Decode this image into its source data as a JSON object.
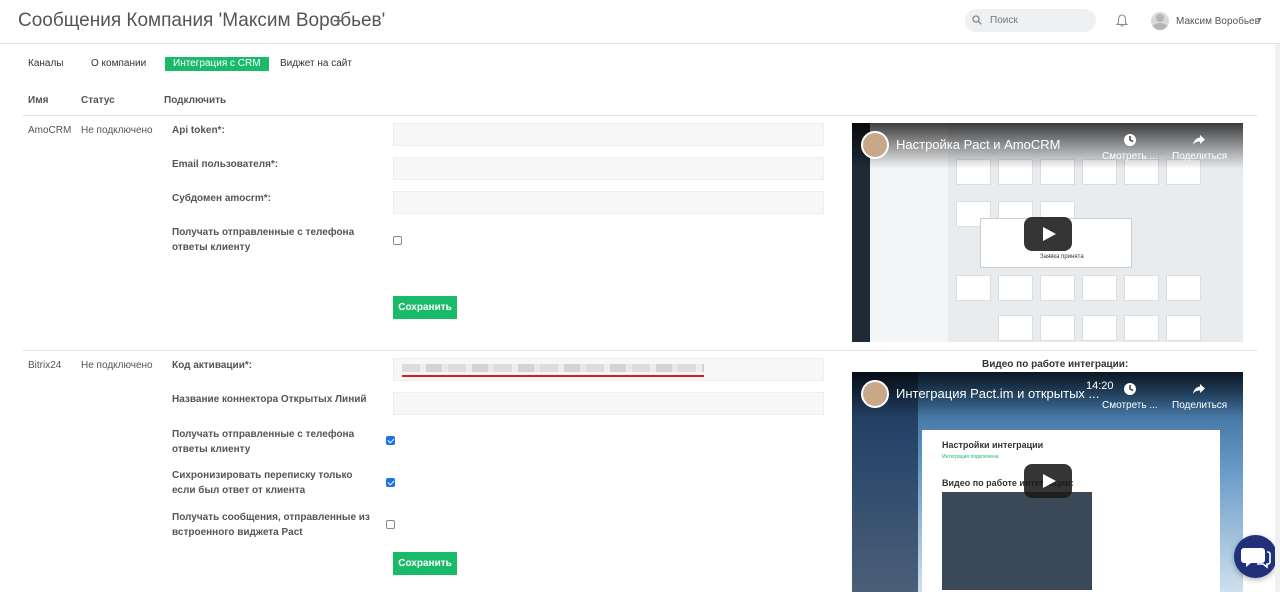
{
  "header": {
    "title": "Сообщения Компания 'Максим Воробьев'",
    "add_label": "+",
    "search_placeholder": "Поиск",
    "user_name": "Максим Воробьев"
  },
  "tabs": [
    {
      "label": "Каналы",
      "active": false
    },
    {
      "label": "О компании",
      "active": false
    },
    {
      "label": "Интеграция с CRM",
      "active": true
    },
    {
      "label": "Виджет на сайт",
      "active": false
    }
  ],
  "columns": [
    "Имя",
    "Статус",
    "Подключить"
  ],
  "integrations": [
    {
      "name": "AmoCRM",
      "status": "Не подключено",
      "fields": [
        {
          "label": "Api token*:",
          "value": ""
        },
        {
          "label": "Email пользователя*:",
          "value": ""
        },
        {
          "label": "Субдомен amocrm*:",
          "value": ""
        }
      ],
      "checkboxes": [
        {
          "label": "Получать отправленные с телефона ответы клиенту",
          "checked": false
        }
      ],
      "save_label": "Сохранить",
      "video": {
        "title": "Настройка Pact и AmoCRM",
        "watch_label": "Смотреть ...",
        "share_label": "Поделиться",
        "popup_text": "Заявка принята"
      }
    },
    {
      "name": "Bitrix24",
      "status": "Не подключено",
      "fields": [
        {
          "label": "Код активации*:",
          "value": ""
        },
        {
          "label": "Название коннектора Открытых Линий",
          "value": ""
        }
      ],
      "checkboxes": [
        {
          "label": "Получать отправленные с телефона ответы клиенту",
          "checked": true
        },
        {
          "label": "Сихронизировать переписку только если был ответ от клиента",
          "checked": true
        },
        {
          "label": "Получать сообщения, отправленные из встроенного виджета Pact",
          "checked": false
        }
      ],
      "save_label": "Сохранить",
      "video_caption": "Видео по работе интеграции:",
      "video": {
        "title": "Интеграция Pact.im и открытых ...",
        "watch_label": "Смотреть ...",
        "share_label": "Поделиться",
        "time": "14:20",
        "page_heading": "Настройки интеграции",
        "page_status": "Интеграция подключена",
        "page_subheading": "Видео по работе интеграции:"
      }
    }
  ],
  "colors": {
    "accent": "#1aba6b",
    "chat": "#20307a",
    "highlight": "#e01b1b"
  }
}
